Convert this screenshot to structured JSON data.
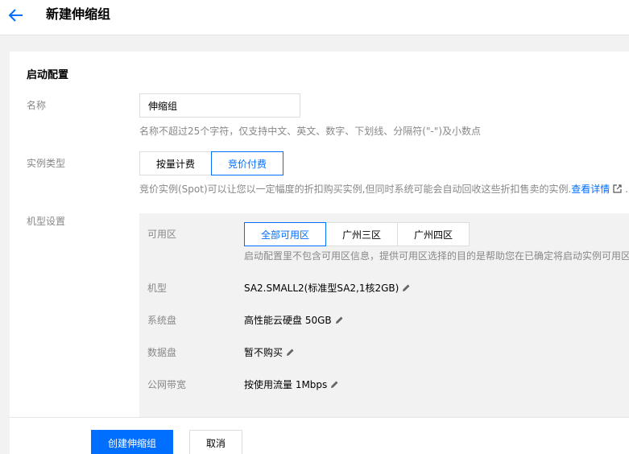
{
  "header": {
    "title": "新建伸缩组"
  },
  "launch_config": {
    "section_title": "启动配置",
    "name": {
      "label": "名称",
      "value": "伸缩组",
      "hint": "名称不超过25个字符，仅支持中文、英文、数字、下划线、分隔符(\"-\")及小数点"
    },
    "instance_type": {
      "label": "实例类型",
      "options": [
        "按量计费",
        "竞价付费"
      ],
      "selected": "竞价付费",
      "hint": "竞价实例(Spot)可以让您以一定幅度的折扣购买实例,但同时系统可能会自动回收这些折扣售卖的实例.",
      "link": "查看详情"
    },
    "machine": {
      "label": "机型设置",
      "zone_label": "可用区",
      "zones": [
        "全部可用区",
        "广州三区",
        "广州四区"
      ],
      "selected_zone": "全部可用区",
      "zone_hint": "启动配置里不包含可用区信息，提供可用区选择的目的是帮助您在已确定将启动实例可用区",
      "model_label": "机型",
      "model_value": "SA2.SMALL2(标准型SA2,1核2GB)",
      "system_disk_label": "系统盘",
      "system_disk_value": "高性能云硬盘 50GB",
      "data_disk_label": "数据盘",
      "data_disk_value": "暂不购买",
      "bandwidth_label": "公网带宽",
      "bandwidth_value": "按使用流量 1Mbps"
    }
  },
  "actions": {
    "create": "创建伸缩组",
    "cancel": "取消"
  },
  "colors": {
    "accent": "#006eff"
  }
}
